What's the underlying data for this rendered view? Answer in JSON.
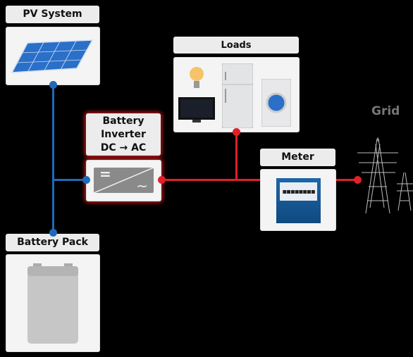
{
  "nodes": {
    "pv": {
      "label": "PV System"
    },
    "battery": {
      "label": "Battery Pack"
    },
    "inverter": {
      "line1": "Battery",
      "line2": "Inverter",
      "line3": "DC → AC",
      "dc_symbol": "=",
      "ac_symbol": "~"
    },
    "loads": {
      "label": "Loads"
    },
    "meter": {
      "label": "Meter"
    },
    "grid": {
      "label": "Grid"
    }
  },
  "colors": {
    "dc_line": "#1e6ab8",
    "ac_line": "#e0202a",
    "grid_label": "#777777"
  }
}
